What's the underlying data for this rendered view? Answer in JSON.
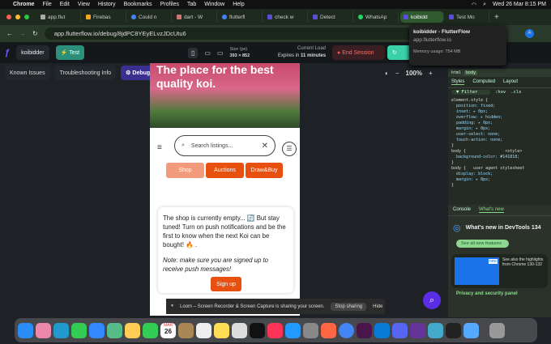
{
  "menubar": {
    "app": "Chrome",
    "items": [
      "File",
      "Edit",
      "View",
      "History",
      "Bookmarks",
      "Profiles",
      "Tab",
      "Window",
      "Help"
    ],
    "datetime": "Wed 26 Mar  8:15 PM"
  },
  "tabs": [
    {
      "label": "app.flut"
    },
    {
      "label": "Firebas"
    },
    {
      "label": "Could n"
    },
    {
      "label": "dart - W"
    },
    {
      "label": "flutterfl"
    },
    {
      "label": "check w"
    },
    {
      "label": "Detect"
    },
    {
      "label": "WhatsAp"
    },
    {
      "label": "koibidd",
      "active": true
    },
    {
      "label": "Test Mo"
    }
  ],
  "address": {
    "url": "app.flutterflow.io/debug/8jdPC8YEyELvzJDcUtu6"
  },
  "tooltip": {
    "title": "koibidder - FlutterFlow",
    "url": "app.flutterflow.io",
    "memory": "Memory usage: 754 MB"
  },
  "toolbar": {
    "project": "koibidder",
    "test": "Test",
    "size_label": "Size (px)",
    "size": "393 × 852",
    "load_label": "Current Load",
    "expires": "Expires in",
    "minutes": "11 minutes",
    "end_session": "End Session"
  },
  "row2": {
    "known_issues": "Known Issues",
    "troubleshooting": "Troubleshooting Info",
    "debug_panel": "Debug Panel",
    "zoom": "100%"
  },
  "app": {
    "hero": "The place for the best quality koi.",
    "search_placeholder": "Search listings...",
    "tabs": [
      "Shop",
      "Auctions",
      "Draw&Buy"
    ],
    "message": "The shop is currently empty... 🔄 But stay tuned! Turn on push notifications and be the first to know when the next Koi can be bought! 🔥 .",
    "note": "Note: make sure you are signed up to receive push messages!",
    "signup": "Sign up"
  },
  "devtools": {
    "crumbs": [
      "html",
      "body"
    ],
    "tabs": [
      "Styles",
      "Computed",
      "Layout"
    ],
    "filter": "Filter",
    "hov": ":hov",
    ".cls": ".cls",
    "rules": [
      "element.style {",
      "  position: fixed;",
      "  inset: ▸ 0px;",
      "  overflow: ▸ hidden;",
      "  padding: ▸ 0px;",
      "  margin: ▸ 0px;",
      "  user-select: none;",
      "  touch-action: none;",
      "}",
      "body {                <style>",
      "  background-color: #141818;",
      "}",
      "body {   user agent stylesheet",
      "  display: block;",
      "  margin: ▸ 8px;",
      "}"
    ],
    "drawer_tabs": [
      "Console",
      "What's new"
    ],
    "whatsnew_title": "What's new in DevTools 134",
    "see_all": "See all new features",
    "new_badge": "new",
    "highlights": "See also the highlights from Chrome 130-132",
    "privacy": "Privacy and security panel"
  },
  "loom": {
    "text": "Loom – Screen Recorder & Screen Capture is sharing your screen.",
    "stop": "Stop sharing",
    "hide": "Hide"
  },
  "dock": {
    "calendar_day": "26",
    "calendar_month": "MAR"
  }
}
